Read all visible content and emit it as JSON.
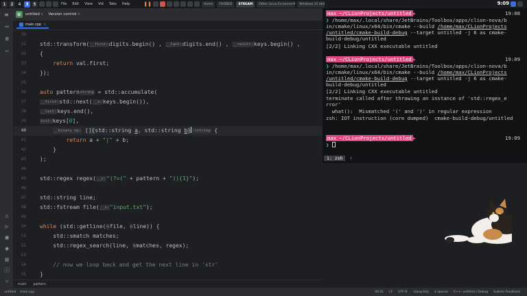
{
  "topbar": {
    "workspaces": [
      "1",
      "2",
      "3",
      "4",
      "5"
    ],
    "active_workspace": "3",
    "menus": [
      "File",
      "Edit",
      "View",
      "Vid",
      "Tabs",
      "Help"
    ],
    "tabs": [
      "Home",
      "FOOBED",
      "STREAM",
      "Other Linux Ex-kernel-ffmpeg",
      "Windows 11 x64"
    ],
    "selected_tab": "STREAM",
    "clock": "9:09"
  },
  "ide": {
    "project_badge": "U",
    "project_name": "untitled",
    "version_control": "Version control",
    "file_tab": "main.cpp",
    "breadcrumb": [
      "main",
      "pattern"
    ],
    "colors": {
      "accent": "#3574f0",
      "keyword": "#cf8e6d",
      "string": "#6aab73",
      "comment": "#7a7e85",
      "number": "#2aacb8"
    }
  },
  "editor": {
    "line_numbers": [
      "30",
      "31",
      "32",
      "33",
      "34",
      "35",
      "36",
      "37",
      "38",
      "39",
      "40",
      "41",
      "42",
      "43",
      "44",
      "45",
      "46",
      "47",
      "48",
      "49",
      "50",
      "51",
      "52",
      "53",
      "54",
      "55"
    ],
    "current_line": "40",
    "hints": {
      "first": "__first:",
      "last": "__last:",
      "result": "__result:",
      "string": "string",
      "binary_op": "__binary_op:",
      "arrow_string": "->string",
      "s": "__s:",
      "ref": "&",
      "init": "init:"
    }
  },
  "terminal": {
    "user": "max",
    "dir": "~/CLionProjects/untitled",
    "time1": "19:08",
    "time2": "19:09",
    "time3": "19:09",
    "cmd_path1": "/home/max/.local/share/JetBrains/Toolbox/apps/clion-nova/bin/cmake/linux/x64/bin/cmake",
    "cmd_build": "--build",
    "cmd_path2": "/home/max/CLionProjects/untitled/cmake-build-debug",
    "cmd_rest": "--target untitled -j 6 as cmake-build-debug/untitled",
    "out_link": "[2/2] Linking CXX executable untitled",
    "out_terminate": "terminate called after throwing an instance of 'std::regex_error'",
    "out_what": "  what():  Mismatched '(' and ')' in regular expression",
    "out_zsh": "zsh: IOT instruction (core dumped)  cmake-build-debug/untitled",
    "tmux_window": "1: zsh",
    "tmux_plus": "+"
  },
  "statusbar": {
    "project": "untitled",
    "file": "main.cpp",
    "position": "40:41",
    "line_ending": "LF",
    "encoding": "UTF-8",
    "formatter": ".clang-tidy",
    "indent": "4 spaces",
    "context": "C++: untitled | Debug",
    "submit": "Submit Feedback"
  }
}
